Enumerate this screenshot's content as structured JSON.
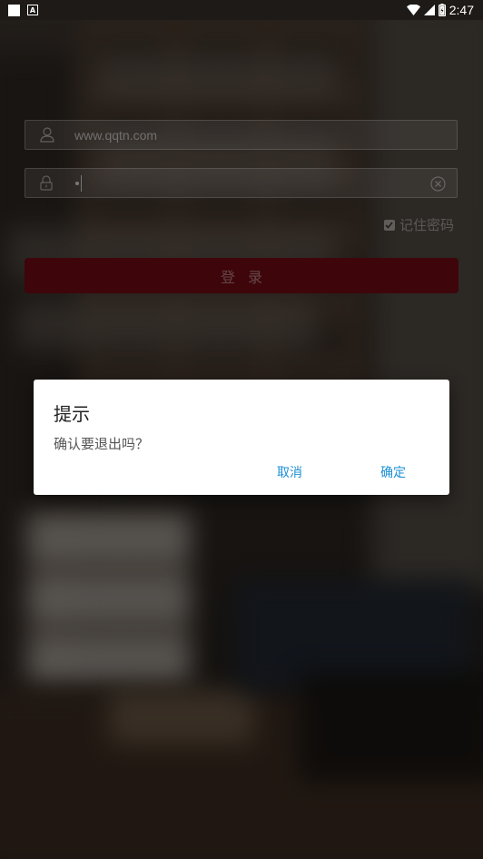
{
  "status_bar": {
    "time": "2:47",
    "notification_icons": [
      "blank-square-icon",
      "a-square-icon"
    ],
    "system_icons": [
      "wifi-icon",
      "cellular-signal-icon",
      "battery-charging-icon"
    ]
  },
  "login": {
    "username_value": "www.qqtn.com",
    "password_mask": "•",
    "remember_label": "记住密码",
    "remember_checked": true,
    "login_label": "登录"
  },
  "dialog": {
    "title": "提示",
    "message": "确认要退出吗？",
    "cancel_label": "取消",
    "confirm_label": "确定"
  },
  "colors": {
    "login_button": "#6b0a12",
    "dialog_action": "#1b8fd6",
    "dim_overlay": "rgba(0,0,0,0.42)"
  }
}
